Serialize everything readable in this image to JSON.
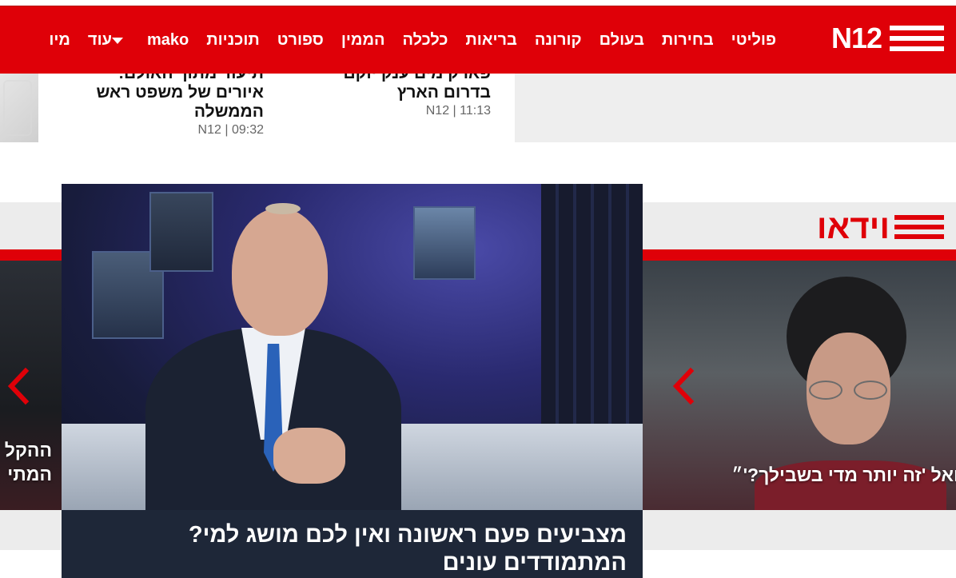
{
  "nav": {
    "logo_text": "N12",
    "items": [
      "פוליטי",
      "בחירות",
      "בעולם",
      "קורונה",
      "בריאות",
      "כלכלה",
      "הממין",
      "ספורט",
      "תוכניות",
      "mako",
      "עוד",
      "מיו"
    ],
    "accent_color": "#df0008"
  },
  "articles": [
    {
      "title": "תיעוד מתוך האולם: איורים של משפט ראש הממשלה",
      "meta": "09:32 | N12"
    },
    {
      "title": "פארק מים ענק יוקם בדרום הארץ",
      "meta": "11:13 | N12"
    }
  ],
  "video_section": {
    "heading": "וידאו",
    "main_caption": "מצביעים פעם ראשונה ואין לכם מושג למי? המתמודדים עונים",
    "right_caption": "ואל 'זה יותר מדי בשבילך?'״",
    "left_caption_line1": "ההקל",
    "left_caption_line2": "המתי"
  },
  "icons": {
    "arrow": "chevron-left-icon"
  }
}
